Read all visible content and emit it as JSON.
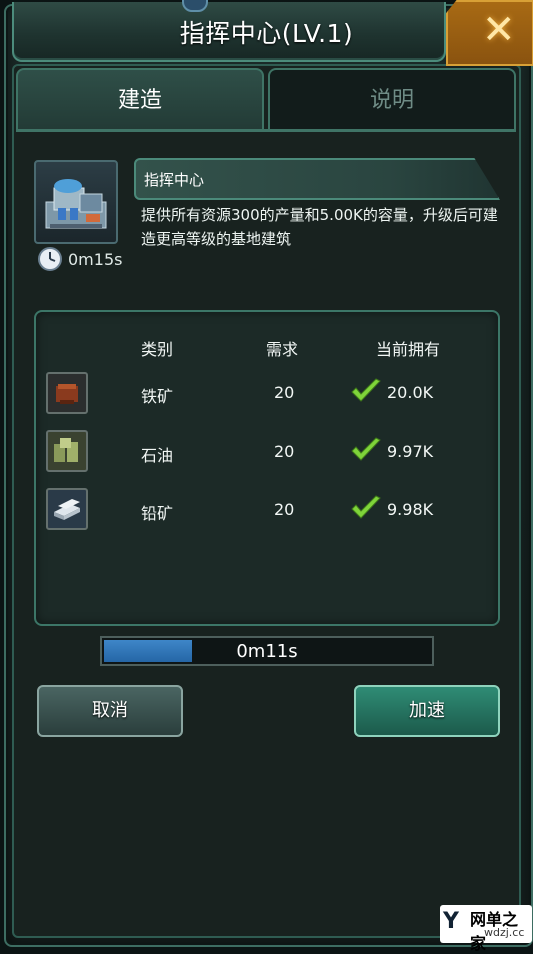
{
  "window": {
    "title": "指挥中心(LV.1)",
    "close_icon": "close-x"
  },
  "tabs": [
    {
      "label": "建造",
      "active": true
    },
    {
      "label": "说明",
      "active": false
    }
  ],
  "building": {
    "name": "指挥中心",
    "description": "提供所有资源300的产量和5.00K的容量，升级后可建造更高等级的基地建筑",
    "build_time": "0m15s",
    "icon": "command-center-icon",
    "clock_icon": "clock-icon"
  },
  "requirements": {
    "headers": {
      "category": "类别",
      "required": "需求",
      "owned": "当前拥有"
    },
    "rows": [
      {
        "name": "铁矿",
        "required": "20",
        "owned": "20.0K",
        "icon": "iron-ore-icon",
        "met": true
      },
      {
        "name": "石油",
        "required": "20",
        "owned": "9.97K",
        "icon": "oil-barrels-icon",
        "met": true
      },
      {
        "name": "铅矿",
        "required": "20",
        "owned": "9.98K",
        "icon": "lead-ore-icon",
        "met": true
      }
    ]
  },
  "progress": {
    "remaining": "0m11s",
    "fraction": 0.27
  },
  "buttons": {
    "cancel": "取消",
    "speed_up": "加速"
  },
  "watermark": {
    "logo": "Y",
    "name": "网单之家",
    "url": "wdzj.cc"
  },
  "colors": {
    "accent": "#3f7466",
    "check": "#7fd43a",
    "progress": "#2f78bd",
    "close": "#a86a14"
  }
}
